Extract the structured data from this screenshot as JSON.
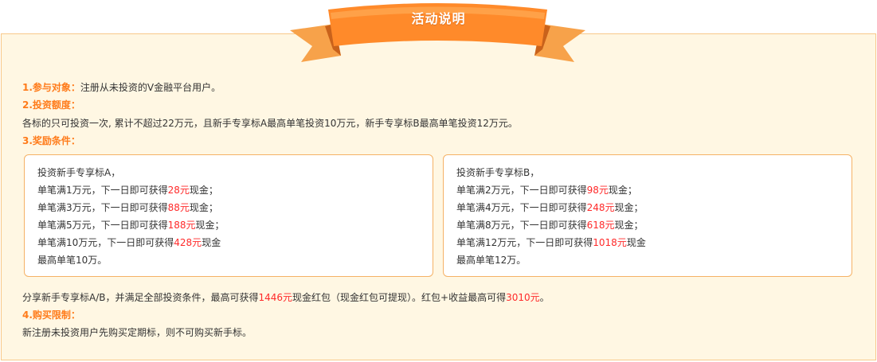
{
  "banner": {
    "title": "活动说明"
  },
  "sections": {
    "target": {
      "heading": "1.参与对象：",
      "text": "注册从未投资的V金融平台用户。"
    },
    "amount": {
      "heading": "2.投资额度：",
      "text": "各标的只可投资一次, 累计不超过22万元，且新手专享标A最高单笔投资10万元，新手专享标B最高单笔投资12万元。"
    },
    "reward": {
      "heading": "3.奖励条件："
    },
    "limit": {
      "heading": "4.购买限制：",
      "text": "新注册未投资用户先购买定期标，则不可购买新手标。"
    }
  },
  "box_a": {
    "title": "投资新手专享标A，",
    "rows": [
      {
        "pre": "单笔满1万元，下一日即可获得",
        "amount": "28元",
        "post": "现金；"
      },
      {
        "pre": "单笔满3万元，下一日即可获得",
        "amount": "88元",
        "post": "现金；"
      },
      {
        "pre": "单笔满5万元，下一日即可获得",
        "amount": "188元",
        "post": "现金；"
      },
      {
        "pre": "单笔满10万元，下一日即可获得",
        "amount": "428元",
        "post": "现金"
      }
    ],
    "footer": "最高单笔10万。"
  },
  "box_b": {
    "title": "投资新手专享标B，",
    "rows": [
      {
        "pre": "单笔满2万元，下一日即可获得",
        "amount": "98元",
        "post": "现金；"
      },
      {
        "pre": "单笔满4万元，下一日即可获得",
        "amount": "248元",
        "post": "现金；"
      },
      {
        "pre": "单笔满8万元，下一日即可获得",
        "amount": "618元",
        "post": "现金；"
      },
      {
        "pre": "单笔满12万元，下一日即可获得",
        "amount": "1018元",
        "post": "现金"
      }
    ],
    "footer": "最高单笔12万。"
  },
  "summary": {
    "part1": "分享新手专享标A/B，并满足全部投资条件，最高可获得",
    "amount1": "1446元",
    "part2": "现金红包（现金红包可提现）。红包+收益最高可得",
    "amount2": "3010元",
    "part3": "。"
  },
  "colors": {
    "heading": "#ff7b1a",
    "highlight": "#ff2a2a",
    "panel_bg": "#fff7e3",
    "panel_border": "#f8c98a",
    "box_border": "#f5b266",
    "ribbon": "#ff8a2a"
  }
}
